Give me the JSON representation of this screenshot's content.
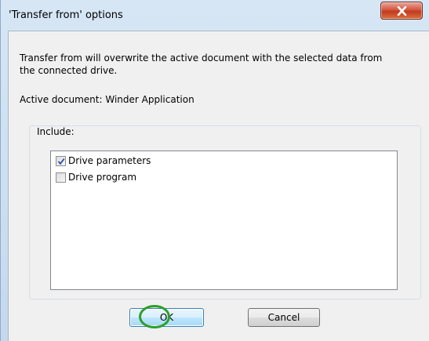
{
  "window": {
    "title": "'Transfer from' options",
    "close_icon": "close-icon"
  },
  "message": {
    "line1": "Transfer from will overwrite the active document with the selected data from",
    "line2": "the connected drive.",
    "active_document": "Active document: Winder Application"
  },
  "include": {
    "label": "Include:",
    "items": [
      {
        "label": "Drive parameters",
        "checked": true
      },
      {
        "label": "Drive program",
        "checked": false
      }
    ]
  },
  "buttons": {
    "ok_label": "OK",
    "cancel_label": "Cancel"
  },
  "colors": {
    "highlight_ring": "#2aa02a",
    "close_button": "#c23a20"
  }
}
